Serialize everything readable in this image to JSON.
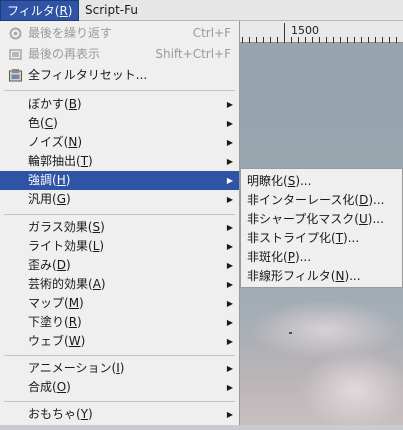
{
  "menubar": {
    "items": [
      {
        "label": "フィルタ(",
        "mn": "R",
        "end": ")"
      },
      {
        "label": "Script-Fu"
      }
    ]
  },
  "ruler": {
    "label": "1500"
  },
  "main_menu": {
    "top_items": [
      {
        "label": "最後を繰り返す",
        "accel": "Ctrl+F",
        "icon": "repeat-icon"
      },
      {
        "label": "最後の再表示",
        "accel": "Shift+Ctrl+F",
        "icon": "reshow-icon"
      },
      {
        "label": "全フィルタリセット...",
        "icon": "reset-icon"
      }
    ],
    "group1": [
      {
        "label": "ぼかす(",
        "mn": "B",
        "end": ")"
      },
      {
        "label": "色(",
        "mn": "C",
        "end": ")"
      },
      {
        "label": "ノイズ(",
        "mn": "N",
        "end": ")"
      },
      {
        "label": "輪郭抽出(",
        "mn": "T",
        "end": ")"
      },
      {
        "label": "強調(",
        "mn": "H",
        "end": ")"
      },
      {
        "label": "汎用(",
        "mn": "G",
        "end": ")"
      }
    ],
    "group2": [
      {
        "label": "ガラス効果(",
        "mn": "S",
        "end": ")"
      },
      {
        "label": "ライト効果(",
        "mn": "L",
        "end": ")"
      },
      {
        "label": "歪み(",
        "mn": "D",
        "end": ")"
      },
      {
        "label": "芸術的効果(",
        "mn": "A",
        "end": ")"
      },
      {
        "label": "マップ(",
        "mn": "M",
        "end": ")"
      },
      {
        "label": "下塗り(",
        "mn": "R",
        "end": ")"
      },
      {
        "label": "ウェブ(",
        "mn": "W",
        "end": ")"
      }
    ],
    "group3": [
      {
        "label": "アニメーション(",
        "mn": "I",
        "end": ")"
      },
      {
        "label": "合成(",
        "mn": "O",
        "end": ")"
      }
    ],
    "group4": [
      {
        "label": "おもちゃ(",
        "mn": "Y",
        "end": ")"
      }
    ]
  },
  "sub_menu": {
    "items": [
      {
        "label": "明瞭化(",
        "mn": "S",
        "end": ")..."
      },
      {
        "label": "非インターレース化(",
        "mn": "D",
        "end": ")..."
      },
      {
        "label": "非シャープ化マスク(",
        "mn": "U",
        "end": ")..."
      },
      {
        "label": "非ストライプ化(",
        "mn": "T",
        "end": ")..."
      },
      {
        "label": "非斑化(",
        "mn": "P",
        "end": ")..."
      },
      {
        "label": "非線形フィルタ(",
        "mn": "N",
        "end": ")..."
      }
    ]
  },
  "colors": {
    "highlight": "#2f54a5",
    "menu_bg": "#efefef",
    "disabled_text": "#9a9a9a"
  }
}
